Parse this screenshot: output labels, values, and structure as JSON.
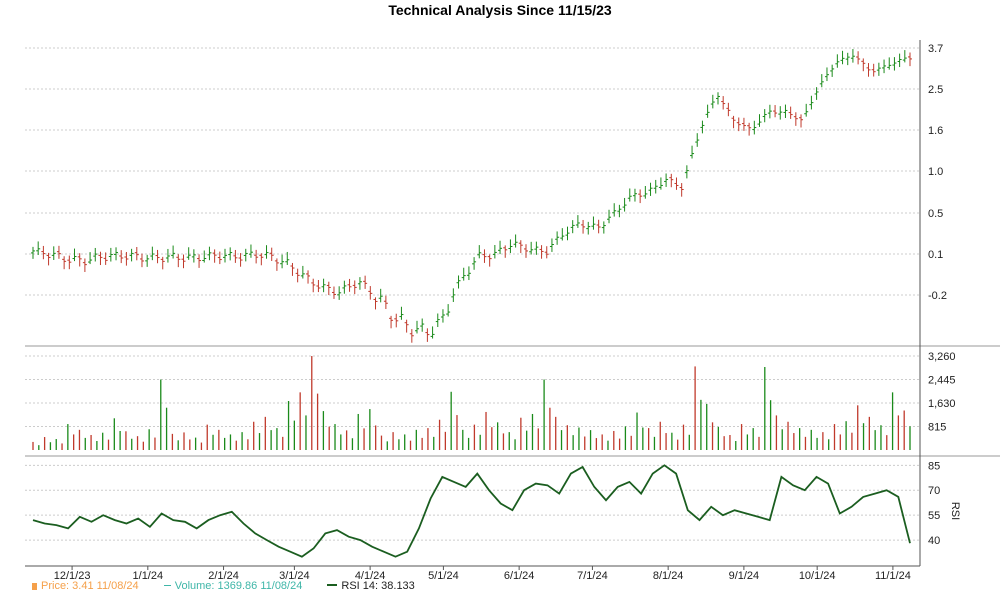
{
  "chart_data": [
    {
      "type": "candlestick",
      "title": "Technical Analysis Since 11/15/23",
      "yticks": [
        "3.7",
        "2.5",
        "1.6",
        "1.0",
        "0.5",
        "0.1",
        "-0.2"
      ],
      "xticks": [
        "12/1/23",
        "1/1/24",
        "2/1/24",
        "3/1/24",
        "4/1/24",
        "5/1/24",
        "6/1/24",
        "7/1/24",
        "8/1/24",
        "9/1/24",
        "10/1/24",
        "11/1/24"
      ],
      "series": [
        {
          "name": "Price",
          "points": [
            [
              "2023-11-15",
              0.13
            ],
            [
              "2023-11-22",
              0.1
            ],
            [
              "2023-11-29",
              0.06
            ],
            [
              "2023-12-06",
              0.05
            ],
            [
              "2023-12-13",
              0.08
            ],
            [
              "2023-12-20",
              0.09
            ],
            [
              "2023-12-27",
              0.08
            ],
            [
              "2024-01-03",
              0.07
            ],
            [
              "2024-01-10",
              0.08
            ],
            [
              "2024-01-17",
              0.07
            ],
            [
              "2024-01-24",
              0.08
            ],
            [
              "2024-01-31",
              0.09
            ],
            [
              "2024-02-07",
              0.08
            ],
            [
              "2024-02-14",
              0.1
            ],
            [
              "2024-02-21",
              0.08
            ],
            [
              "2024-02-28",
              0.02
            ],
            [
              "2024-03-06",
              -0.08
            ],
            [
              "2024-03-13",
              -0.15
            ],
            [
              "2024-03-20",
              -0.18
            ],
            [
              "2024-03-27",
              -0.1
            ],
            [
              "2024-04-03",
              -0.2
            ],
            [
              "2024-04-10",
              -0.28
            ],
            [
              "2024-04-17",
              -0.33
            ],
            [
              "2024-04-24",
              -0.35
            ],
            [
              "2024-05-01",
              -0.3
            ],
            [
              "2024-05-08",
              -0.1
            ],
            [
              "2024-05-15",
              0.08
            ],
            [
              "2024-05-22",
              0.1
            ],
            [
              "2024-05-29",
              0.2
            ],
            [
              "2024-06-05",
              0.15
            ],
            [
              "2024-06-12",
              0.12
            ],
            [
              "2024-06-19",
              0.3
            ],
            [
              "2024-06-26",
              0.4
            ],
            [
              "2024-07-03",
              0.35
            ],
            [
              "2024-07-10",
              0.5
            ],
            [
              "2024-07-17",
              0.7
            ],
            [
              "2024-07-24",
              0.75
            ],
            [
              "2024-07-31",
              0.9
            ],
            [
              "2024-08-07",
              0.8
            ],
            [
              "2024-08-14",
              1.6
            ],
            [
              "2024-08-21",
              2.4
            ],
            [
              "2024-08-28",
              1.8
            ],
            [
              "2024-09-04",
              1.6
            ],
            [
              "2024-09-11",
              2.0
            ],
            [
              "2024-09-18",
              2.0
            ],
            [
              "2024-09-25",
              1.8
            ],
            [
              "2024-10-02",
              2.6
            ],
            [
              "2024-10-09",
              3.3
            ],
            [
              "2024-10-16",
              3.5
            ],
            [
              "2024-10-23",
              3.0
            ],
            [
              "2024-10-30",
              3.2
            ],
            [
              "2024-11-06",
              3.4
            ],
            [
              "2024-11-08",
              3.41
            ]
          ]
        },
        {
          "name": "Volume",
          "values": [
            280,
            450,
            380,
            900,
            700,
            520,
            600,
            1100,
            650,
            480,
            720,
            2445,
            560,
            610,
            430,
            880,
            700,
            540,
            620,
            980,
            1150,
            760,
            1700,
            2000,
            3260,
            1350,
            900,
            680,
            1250,
            1420,
            500,
            620,
            540,
            700,
            760,
            1050,
            2020,
            700,
            880,
            1320,
            960,
            620,
            1120,
            1250,
            2445,
            1150,
            860,
            780,
            690,
            540,
            660,
            820,
            1300,
            760,
            980,
            600,
            880,
            2900,
            1600,
            800,
            520,
            900,
            760,
            2880,
            1200,
            980,
            760,
            700,
            620,
            900,
            1000,
            1550,
            1150,
            860,
            2000,
            1370
          ]
        },
        {
          "name": "RSI 14",
          "values": [
            52,
            50,
            49,
            47,
            54,
            51,
            55,
            52,
            50,
            53,
            48,
            56,
            52,
            51,
            47,
            52,
            55,
            57,
            50,
            44,
            40,
            36,
            33,
            30,
            35,
            44,
            46,
            42,
            40,
            36,
            33,
            30,
            33,
            47,
            65,
            78,
            75,
            72,
            80,
            70,
            62,
            58,
            70,
            74,
            73,
            68,
            80,
            84,
            72,
            64,
            72,
            75,
            68,
            80,
            85,
            80,
            58,
            52,
            60,
            55,
            58,
            56,
            54,
            52,
            78,
            73,
            70,
            78,
            74,
            56,
            60,
            66,
            68,
            70,
            66,
            38.13
          ]
        }
      ],
      "ylim_rsi": [
        28,
        87
      ],
      "yticks_rsi": [
        "85",
        "70",
        "55",
        "40"
      ],
      "ylabel_rsi": "RSI",
      "yticks_volume": [
        "3,260",
        "2,445",
        "1,630",
        "815"
      ],
      "grid": true,
      "legend": {
        "price": "Price: 3.41  11/08/24",
        "volume": "Volume: 1369.86  11/08/24",
        "rsi": "RSI 14: 38.133"
      },
      "colors": {
        "up": "#1a8a1a",
        "down": "#c0392b",
        "rsi": "#1b5e20",
        "grid": "#cccccc"
      }
    }
  ]
}
